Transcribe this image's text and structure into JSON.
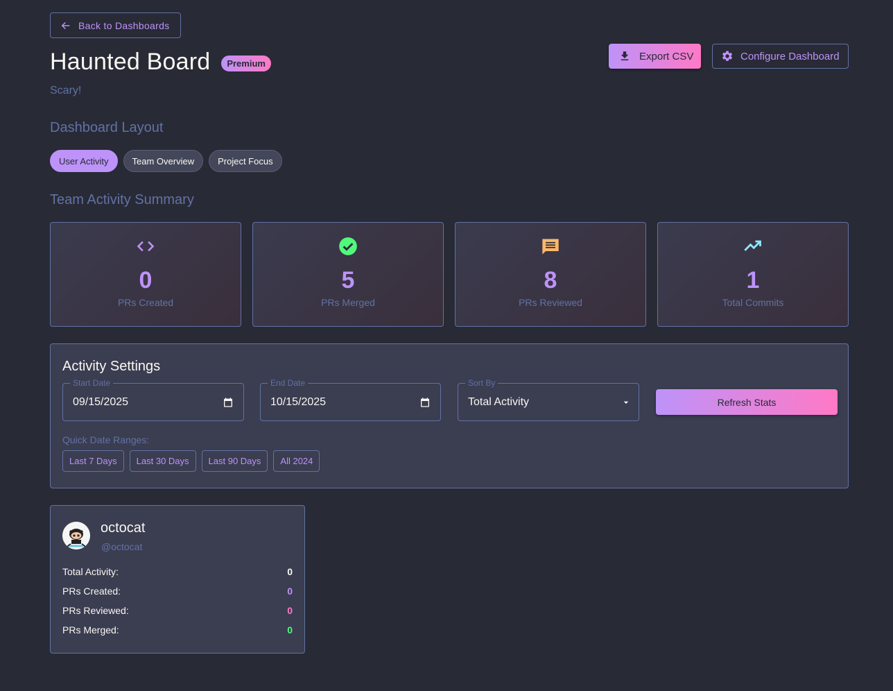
{
  "nav": {
    "back_label": "Back to Dashboards"
  },
  "header": {
    "title": "Haunted Board",
    "badge": "Premium",
    "subtitle": "Scary!",
    "export_label": "Export CSV",
    "configure_label": "Configure Dashboard"
  },
  "layout": {
    "heading": "Dashboard Layout",
    "options": [
      "User Activity",
      "Team Overview",
      "Project Focus"
    ],
    "selected": "User Activity"
  },
  "summary": {
    "heading": "Team Activity Summary",
    "cards": [
      {
        "icon": "code-icon",
        "value": "0",
        "label": "PRs Created",
        "icon_color": "#bd93f9"
      },
      {
        "icon": "check-circle-icon",
        "value": "5",
        "label": "PRs Merged",
        "icon_color": "#50fa7b"
      },
      {
        "icon": "comment-icon",
        "value": "8",
        "label": "PRs Reviewed",
        "icon_color": "#ffb86c"
      },
      {
        "icon": "trending-up-icon",
        "value": "1",
        "label": "Total Commits",
        "icon_color": "#8be9fd"
      }
    ]
  },
  "settings": {
    "heading": "Activity Settings",
    "start_date": {
      "label": "Start Date",
      "value": "09/15/2025"
    },
    "end_date": {
      "label": "End Date",
      "value": "10/15/2025"
    },
    "sort_by": {
      "label": "Sort By",
      "value": "Total Activity"
    },
    "refresh_label": "Refresh Stats",
    "quick_label": "Quick Date Ranges:",
    "quick_ranges": [
      "Last 7 Days",
      "Last 30 Days",
      "Last 90 Days",
      "All 2024"
    ]
  },
  "user": {
    "name": "octocat",
    "handle": "@octocat",
    "stats": [
      {
        "label": "Total Activity:",
        "value": "0",
        "color": "#f8f8f2"
      },
      {
        "label": "PRs Created:",
        "value": "0",
        "color": "#bd93f9"
      },
      {
        "label": "PRs Reviewed:",
        "value": "0",
        "color": "#ff79c6"
      },
      {
        "label": "PRs Merged:",
        "value": "0",
        "color": "#50fa7b"
      }
    ]
  },
  "colors": {
    "background": "#282a36",
    "accent_purple": "#bd93f9",
    "accent_pink": "#ff79c6",
    "muted": "#6272a4"
  }
}
